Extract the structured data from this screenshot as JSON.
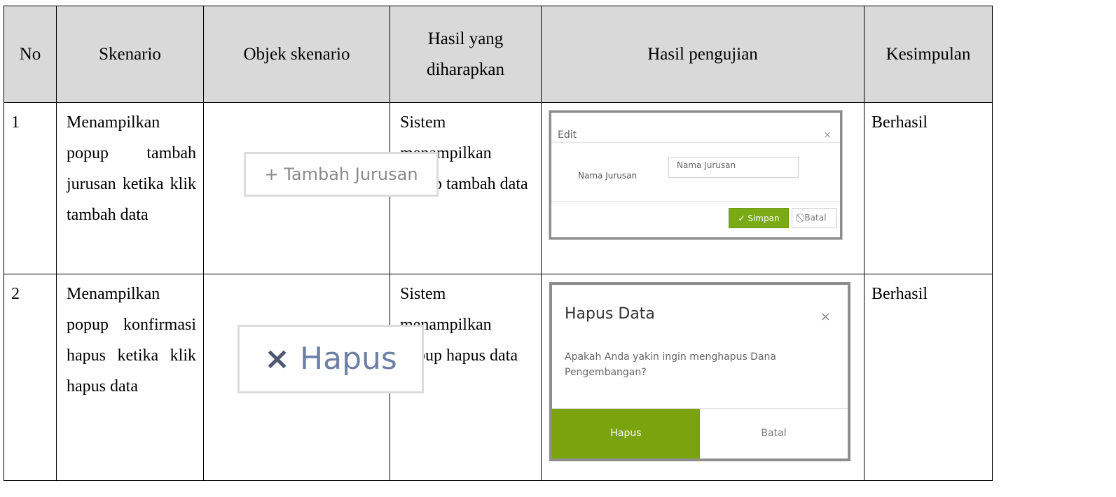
{
  "headers": {
    "no": "No",
    "skenario": "Skenario",
    "objek": "Objek skenario",
    "hasil_harapan": "Hasil yang diharapkan",
    "hasil_uji": "Hasil pengujian",
    "kesimpulan": "Kesimpulan"
  },
  "rows": [
    {
      "no": "1",
      "skenario": "Menampilkan popup tambah jurusan ketika klik tambah data",
      "objek_button": {
        "icon": "plus-icon",
        "label": "Tambah Jurusan",
        "symbol": "+"
      },
      "hasil_harapan": "Sistem menampilkan popup tambah data",
      "popup": {
        "title": "Edit",
        "close": "×",
        "field_label": "Nama Jurusan",
        "field_placeholder": "Nama Jurusan",
        "save_label": "Simpan",
        "cancel_label": "Batal",
        "save_color": "#7aab17"
      },
      "kesimpulan": "Berhasil"
    },
    {
      "no": "2",
      "skenario": "Menampilkan popup konfirmasi hapus ketika klik hapus data",
      "objek_button": {
        "icon": "x-icon",
        "label": "Hapus",
        "symbol": "×"
      },
      "hasil_harapan": "Sistem menampilkan popup hapus data",
      "popup": {
        "title": "Hapus Data",
        "close": "×",
        "message": "Apakah Anda yakin ingin menghapus Dana Pengembangan?",
        "confirm_label": "Hapus",
        "cancel_label": "Batal",
        "confirm_color": "#7aa30d"
      },
      "kesimpulan": "Berhasil"
    }
  ]
}
